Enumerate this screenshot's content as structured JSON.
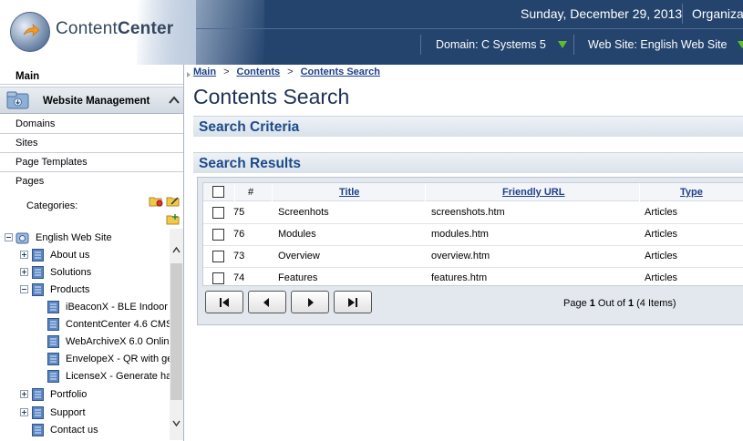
{
  "header": {
    "app_name_light": "Content",
    "app_name_bold": "Center",
    "date": "Sunday, December 29, 2013",
    "organization": "Organizat",
    "domain_selector": "Domain: C Systems 5",
    "website_selector": "Web Site: English Web Site"
  },
  "sidebar": {
    "main_label": "Main",
    "section_label": "Website Management",
    "items": [
      {
        "label": "Domains"
      },
      {
        "label": "Sites"
      },
      {
        "label": "Page Templates"
      },
      {
        "label": "Pages"
      }
    ],
    "categories_label": "Categories:",
    "tree": [
      {
        "label": "English Web Site",
        "level": 0,
        "toggle": "minus"
      },
      {
        "label": "About us",
        "level": 1,
        "toggle": "plus"
      },
      {
        "label": "Solutions",
        "level": 1,
        "toggle": "plus"
      },
      {
        "label": "Products",
        "level": 1,
        "toggle": "minus"
      },
      {
        "label": "iBeaconX - BLE Indoor",
        "level": 2,
        "toggle": "none"
      },
      {
        "label": "ContentCenter 4.6 CMS",
        "level": 2,
        "toggle": "none"
      },
      {
        "label": "WebArchiveX 6.0 Onlin",
        "level": 2,
        "toggle": "none"
      },
      {
        "label": "EnvelopeX - QR with ge",
        "level": 2,
        "toggle": "none"
      },
      {
        "label": "LicenseX - Generate ha",
        "level": 2,
        "toggle": "none"
      },
      {
        "label": "Portfolio",
        "level": 1,
        "toggle": "plus"
      },
      {
        "label": "Support",
        "level": 1,
        "toggle": "plus"
      },
      {
        "label": "Contact us",
        "level": 1,
        "toggle": "none"
      }
    ]
  },
  "breadcrumb": {
    "items": [
      "Main",
      "Contents",
      "Contents Search"
    ],
    "separator": ">"
  },
  "page_title": "Contents Search",
  "search_criteria_label": "Search Criteria",
  "search_results_label": "Search Results",
  "grid": {
    "headers": {
      "number": "#",
      "title": "Title",
      "friendly_url": "Friendly URL",
      "type": "Type"
    },
    "rows": [
      {
        "id": "75",
        "title": "Screenhots",
        "url": "screenshots.htm",
        "type": "Articles"
      },
      {
        "id": "76",
        "title": "Modules",
        "url": "modules.htm",
        "type": "Articles"
      },
      {
        "id": "73",
        "title": "Overview",
        "url": "overview.htm",
        "type": "Articles"
      },
      {
        "id": "74",
        "title": "Features",
        "url": "features.htm",
        "type": "Articles"
      }
    ]
  },
  "pager": {
    "prefix": "Page ",
    "current": "1",
    "middle": " Out of ",
    "total": "1",
    "suffix": " (4 Items)"
  },
  "colors": {
    "header_bg": "#24446e",
    "accent_green": "#5fbf2a",
    "title_blue": "#1d4a8b"
  }
}
